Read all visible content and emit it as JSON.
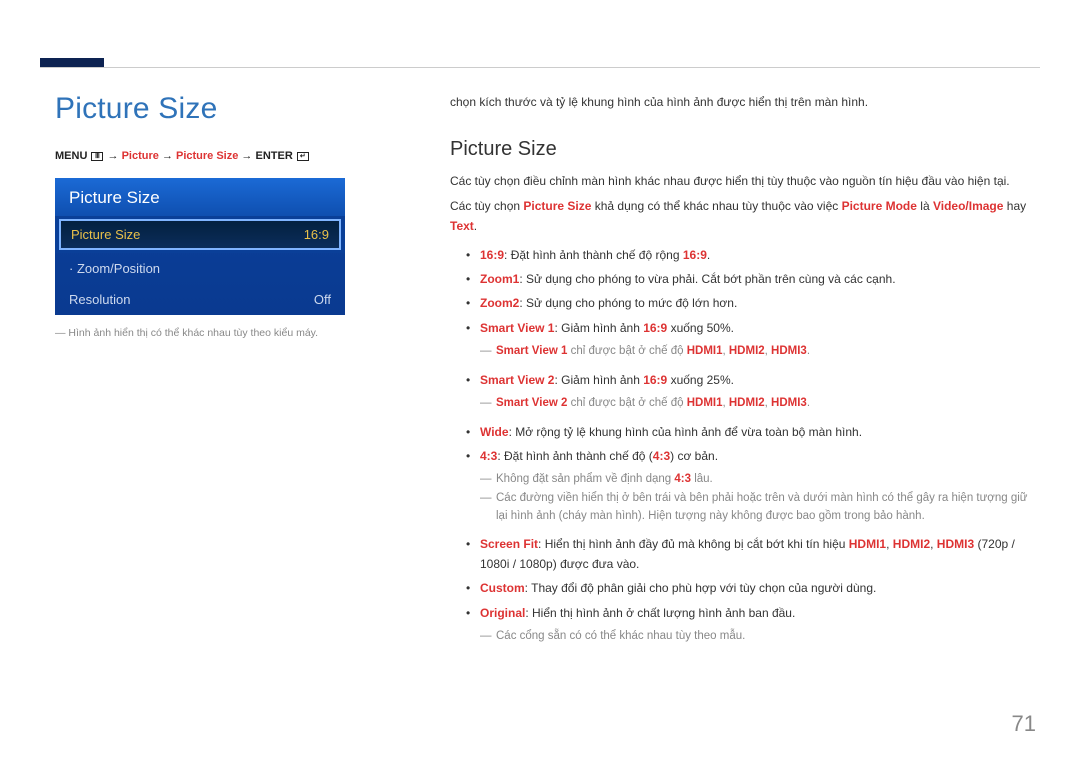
{
  "page_number": "71",
  "left": {
    "main_title": "Picture Size",
    "breadcrumb": {
      "menu": "MENU",
      "arrow": " → ",
      "p1": "Picture",
      "p2": "Picture Size",
      "enter": "ENTER"
    },
    "menu": {
      "title": "Picture Size",
      "row_sel_label": "Picture Size",
      "row_sel_value": "16:9",
      "row2_label": "· Zoom/Position",
      "row2_value": "",
      "row3_label": "Resolution",
      "row3_value": "Off"
    },
    "image_note": "Hình ảnh hiển thị có thể khác nhau tùy theo kiểu máy."
  },
  "right": {
    "intro": "chọn kích thước và tỷ lệ khung hình của hình ảnh được hiển thị trên màn hình.",
    "subtitle": "Picture Size",
    "para1_pre": "Các tùy chọn điều chỉnh màn hình khác nhau được hiển thị tùy thuộc vào nguồn tín hiệu đầu vào hiện tại.",
    "para2_a": "Các tùy chọn ",
    "para2_hl1": "Picture Size",
    "para2_b": " khả dụng có thể khác nhau tùy thuộc vào việc ",
    "para2_hl2": "Picture Mode",
    "para2_c": " là ",
    "para2_hl3": "Video/Image",
    "para2_d": " hay ",
    "para2_hl4": "Text",
    "para2_e": ".",
    "b1_hl": "16:9",
    "b1_t1": ": Đặt hình ảnh thành chế độ rộng ",
    "b1_hl2": "16:9",
    "b1_t2": ".",
    "b2_hl": "Zoom1",
    "b2_t": ": Sử dụng cho phóng to vừa phải. Cắt bớt phần trên cùng và các cạnh.",
    "b3_hl": "Zoom2",
    "b3_t": ": Sử dụng cho phóng to mức độ lớn hơn.",
    "b4_hl": "Smart View 1",
    "b4_t1": ": Giảm hình ảnh ",
    "b4_hl2": "16:9",
    "b4_t2": " xuống 50%.",
    "n4_hl": "Smart View 1",
    "n4_t1": " chỉ được bật ở chế độ ",
    "n4_hl2": "HDMI1",
    "n4_c": ", ",
    "n4_hl3": "HDMI2",
    "n4_hl4": "HDMI3",
    "n4_end": ".",
    "b5_hl": "Smart View 2",
    "b5_t1": ": Giảm hình ảnh ",
    "b5_hl2": "16:9",
    "b5_t2": " xuống 25%.",
    "n5_hl": "Smart View 2",
    "n5_t1": " chỉ được bật ở chế độ ",
    "n5_hl2": "HDMI1",
    "n5_hl3": "HDMI2",
    "n5_hl4": "HDMI3",
    "n5_end": ".",
    "b6_hl": "Wide",
    "b6_t": ": Mở rộng tỷ lệ khung hình của hình ảnh để vừa toàn bộ màn hình.",
    "b7_hl": "4:3",
    "b7_t1": ": Đặt hình ảnh thành chế độ (",
    "b7_hl2": "4:3",
    "b7_t2": ") cơ bản.",
    "n7a_t1": "Không đặt sản phẩm về định dạng ",
    "n7a_hl": "4:3",
    "n7a_t2": " lâu.",
    "n7b": "Các đường viền hiển thị ở bên trái và bên phải hoặc trên và dưới màn hình có thể gây ra hiện tượng giữ lại hình ảnh (cháy màn hình). Hiện tượng này không được bao gồm trong bảo hành.",
    "b8_hl": "Screen Fit",
    "b8_t1": ": Hiển thị hình ảnh đầy đủ mà không bị cắt bớt khi tín hiệu ",
    "b8_hl2": "HDMI1",
    "b8_hl3": "HDMI2",
    "b8_hl4": "HDMI3",
    "b8_t2": " (720p / 1080i / 1080p) được đưa vào.",
    "b9_hl": "Custom",
    "b9_t": ": Thay đổi độ phân giải cho phù hợp với tùy chọn của người dùng.",
    "b10_hl": "Original",
    "b10_t": ": Hiển thị hình ảnh ở chất lượng hình ảnh ban đầu.",
    "n10": "Các cổng sẵn có có thể khác nhau tùy theo mẫu."
  }
}
